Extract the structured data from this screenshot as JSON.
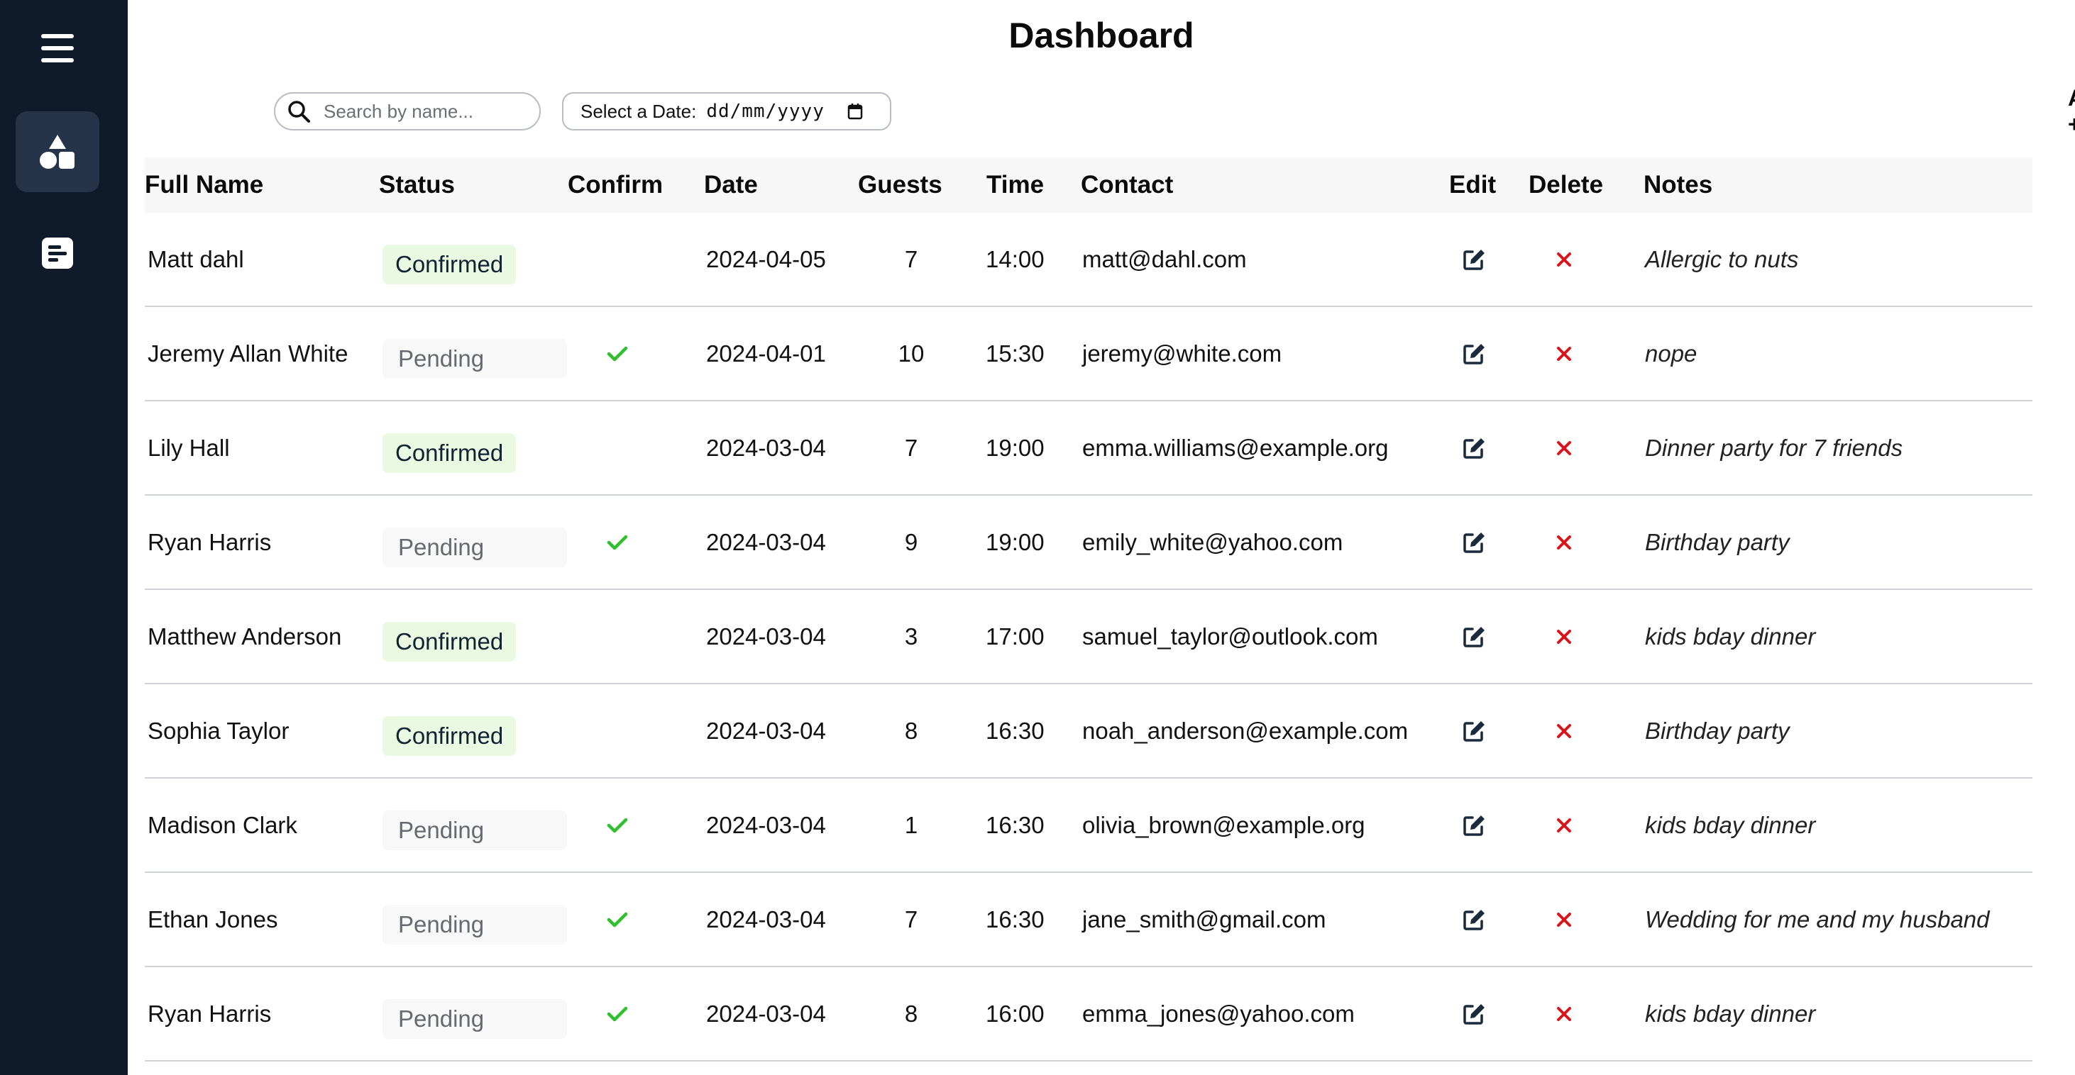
{
  "header": {
    "title": "Dashboard"
  },
  "toolbar": {
    "search_placeholder": "Search by name...",
    "date_label": "Select a Date:",
    "date_value": "dd/mm/yyyy",
    "add_label": "Add +"
  },
  "sidebar": {
    "items": [
      {
        "icon": "menu-icon"
      },
      {
        "icon": "shapes-icon",
        "active": true
      },
      {
        "icon": "notes-icon"
      }
    ]
  },
  "colors": {
    "sidebar_bg": "#0f1a2a",
    "sidebar_active": "#253448",
    "confirmed_bg": "#eaf9e1",
    "check": "#2fbf2f",
    "delete": "#d9141b",
    "edit": "#1b2a3c"
  },
  "table": {
    "headers": [
      "Full Name",
      "Status",
      "Confirm",
      "Date",
      "Guests",
      "Time",
      "Contact",
      "Edit",
      "Delete",
      "Notes"
    ],
    "rows": [
      {
        "name": "Matt dahl",
        "status": "Confirmed",
        "date": "2024-04-05",
        "guests": "7",
        "time": "14:00",
        "contact": "matt@dahl.com",
        "notes": "Allergic to nuts"
      },
      {
        "name": "Jeremy Allan White",
        "status": "Pending",
        "date": "2024-04-01",
        "guests": "10",
        "time": "15:30",
        "contact": "jeremy@white.com",
        "notes": "nope"
      },
      {
        "name": "Lily Hall",
        "status": "Confirmed",
        "date": "2024-03-04",
        "guests": "7",
        "time": "19:00",
        "contact": "emma.williams@example.org",
        "notes": "Dinner party for 7 friends"
      },
      {
        "name": "Ryan Harris",
        "status": "Pending",
        "date": "2024-03-04",
        "guests": "9",
        "time": "19:00",
        "contact": "emily_white@yahoo.com",
        "notes": "Birthday party"
      },
      {
        "name": "Matthew Anderson",
        "status": "Confirmed",
        "date": "2024-03-04",
        "guests": "3",
        "time": "17:00",
        "contact": "samuel_taylor@outlook.com",
        "notes": "kids bday dinner"
      },
      {
        "name": "Sophia Taylor",
        "status": "Confirmed",
        "date": "2024-03-04",
        "guests": "8",
        "time": "16:30",
        "contact": "noah_anderson@example.com",
        "notes": "Birthday party"
      },
      {
        "name": "Madison Clark",
        "status": "Pending",
        "date": "2024-03-04",
        "guests": "1",
        "time": "16:30",
        "contact": "olivia_brown@example.org",
        "notes": "kids bday dinner"
      },
      {
        "name": "Ethan Jones",
        "status": "Pending",
        "date": "2024-03-04",
        "guests": "7",
        "time": "16:30",
        "contact": "jane_smith@gmail.com",
        "notes": "Wedding for me and my husband"
      },
      {
        "name": "Ryan Harris",
        "status": "Pending",
        "date": "2024-03-04",
        "guests": "8",
        "time": "16:00",
        "contact": "emma_jones@yahoo.com",
        "notes": "kids bday dinner"
      }
    ]
  }
}
